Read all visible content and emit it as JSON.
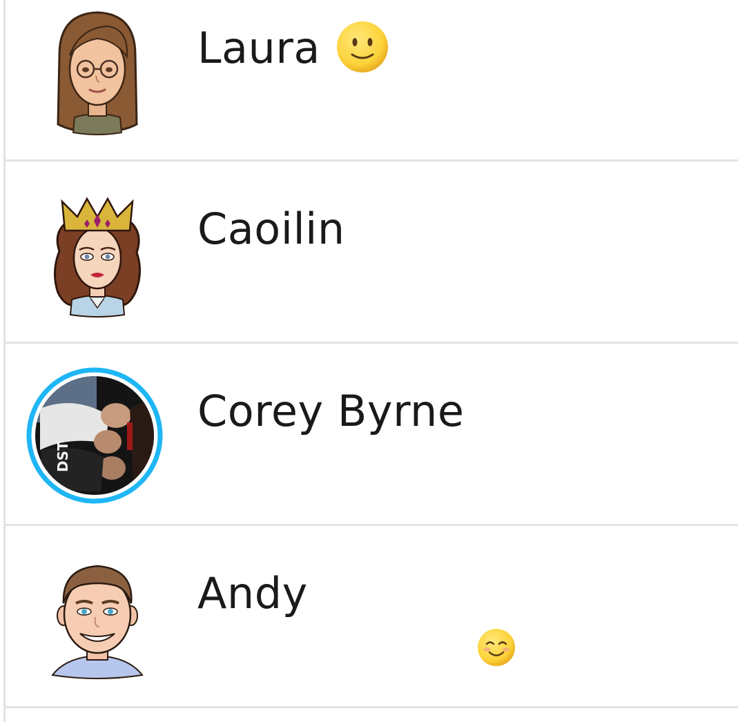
{
  "friends": [
    {
      "name": "Laura",
      "avatar": "bitmoji-avatar",
      "name_emoji": "slightly-smiling-face-emoji"
    },
    {
      "name": "Caoilin",
      "avatar": "bitmoji-avatar-crown"
    },
    {
      "name": "Corey Byrne",
      "avatar": "photo-avatar-with-story-ring",
      "story_ring_color": "#1fb6f5"
    },
    {
      "name": "Andy",
      "avatar": "bitmoji-avatar",
      "status_emoji": "smiling-face-emoji"
    }
  ],
  "colors": {
    "divider": "#e2e2e6",
    "text": "#1a1a1a",
    "story_ring": "#1fb6f5",
    "emoji_yellow": "#fcd33a"
  }
}
